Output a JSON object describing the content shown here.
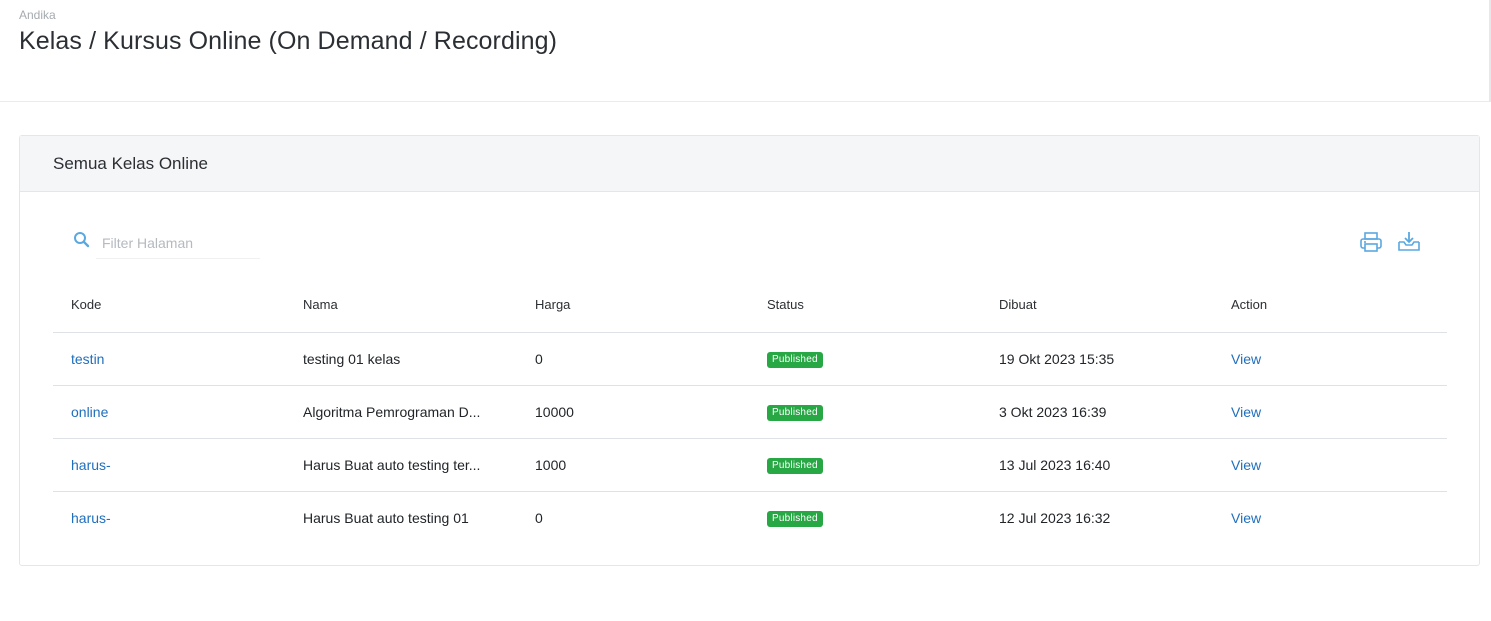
{
  "header": {
    "breadcrumb": "Andika",
    "title": "Kelas / Kursus Online (On Demand / Recording)"
  },
  "card": {
    "title": "Semua Kelas Online"
  },
  "search": {
    "placeholder": "Filter Halaman",
    "icon": "search-icon"
  },
  "toolbar": {
    "print_icon": "print-icon",
    "download_icon": "download-icon",
    "accent_color": "#5aa8e0"
  },
  "table": {
    "columns": [
      "Kode",
      "Nama",
      "Harga",
      "Status",
      "Dibuat",
      "Action"
    ],
    "rows": [
      {
        "kode": "testin",
        "nama": "testing 01 kelas",
        "harga": "0",
        "status": "Published",
        "dibuat": "19 Okt 2023 15:35",
        "action": "View"
      },
      {
        "kode": "online",
        "nama": "Algoritma Pemrograman D...",
        "harga": "10000",
        "status": "Published",
        "dibuat": "3 Okt 2023 16:39",
        "action": "View"
      },
      {
        "kode": "harus-",
        "nama": "Harus Buat auto testing ter...",
        "harga": "1000",
        "status": "Published",
        "dibuat": "13 Jul 2023 16:40",
        "action": "View"
      },
      {
        "kode": "harus-",
        "nama": "Harus Buat auto testing 01",
        "harga": "0",
        "status": "Published",
        "dibuat": "12 Jul 2023 16:32",
        "action": "View"
      }
    ]
  },
  "colors": {
    "link": "#1f6fbd",
    "badge_published": "#28a745"
  }
}
